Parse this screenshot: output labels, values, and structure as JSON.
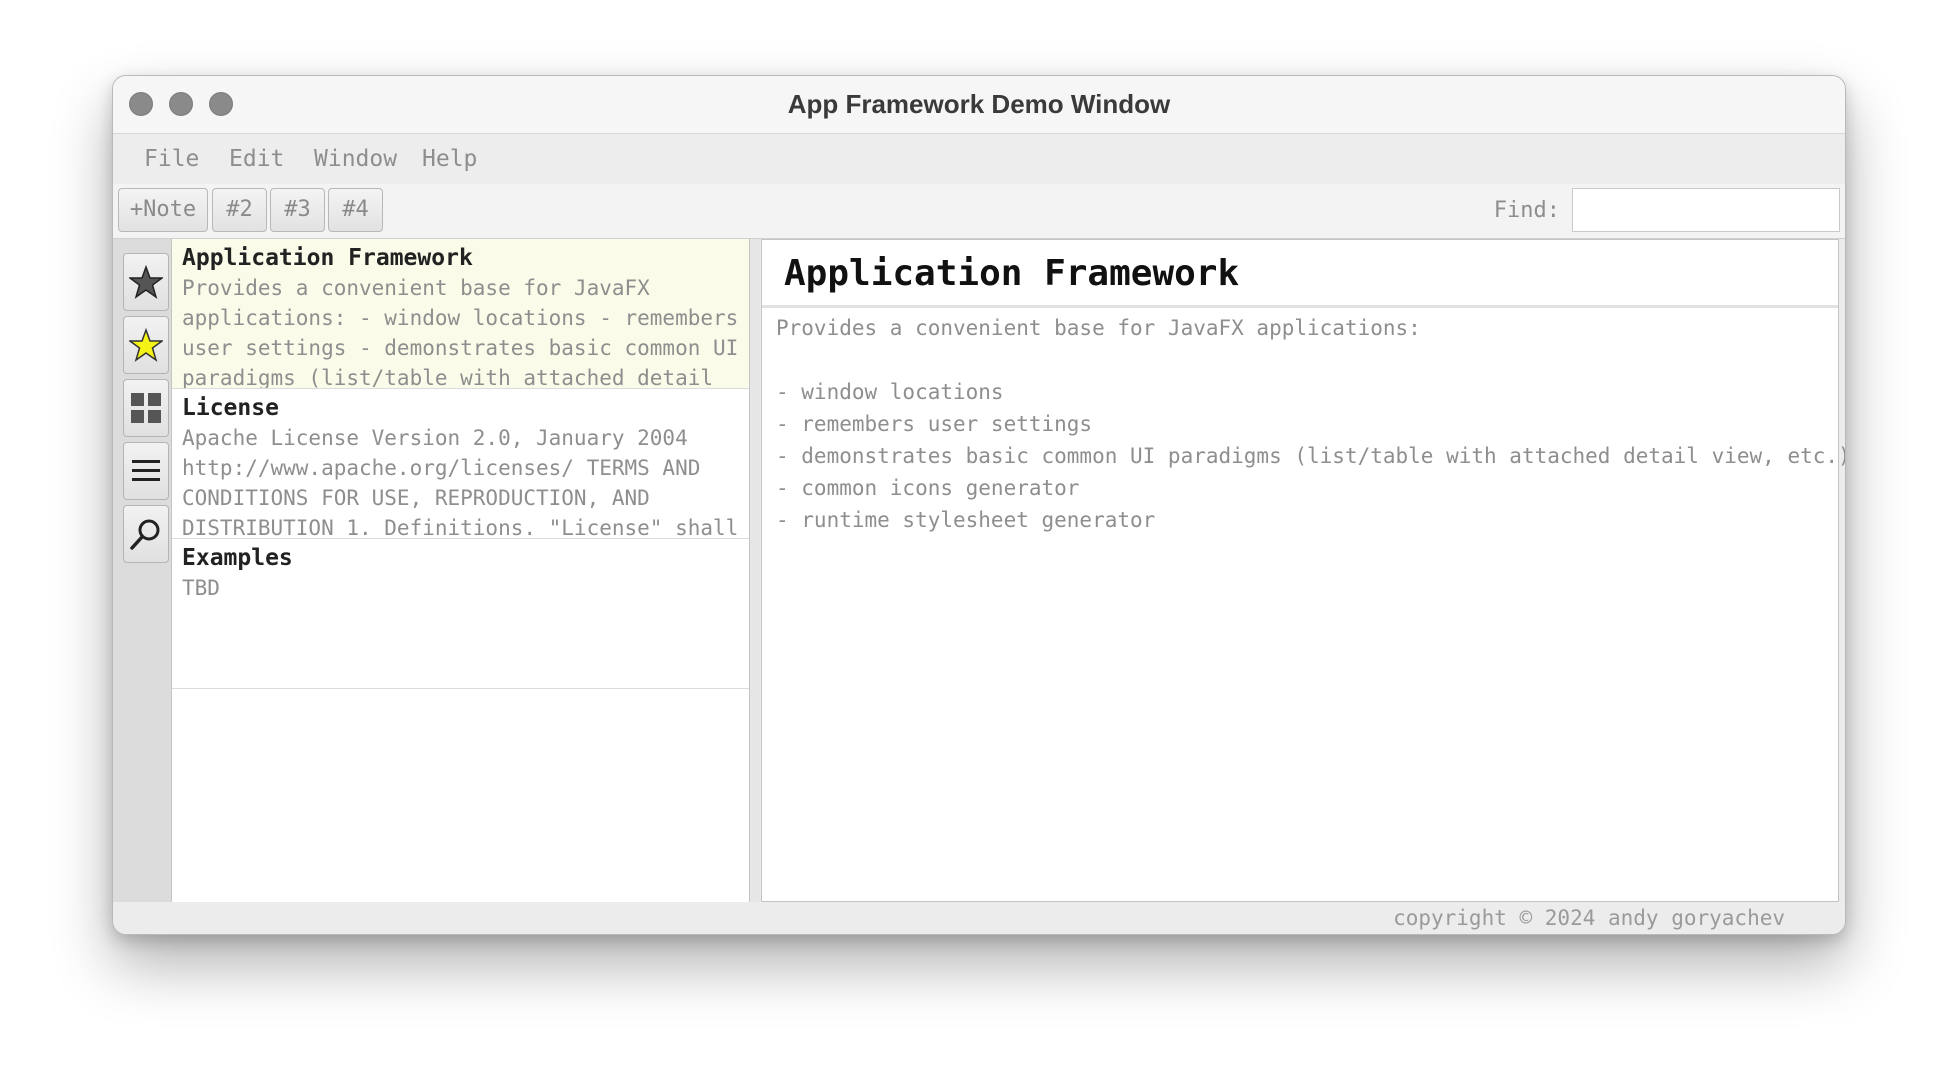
{
  "window": {
    "title": "App Framework Demo Window"
  },
  "menu": {
    "items": [
      "File",
      "Edit",
      "Window",
      "Help"
    ]
  },
  "toolbar": {
    "buttons": [
      "+Note",
      "#2",
      "#3",
      "#4"
    ],
    "find_label": "Find:",
    "find_value": ""
  },
  "sidebar": {
    "buttons": [
      {
        "name": "star-outline-icon",
        "color": "#555555"
      },
      {
        "name": "star-yellow-icon",
        "color": "#f5f216"
      },
      {
        "name": "grid-icon",
        "color": "#555555"
      },
      {
        "name": "list-lines-icon",
        "color": "#222222"
      },
      {
        "name": "search-icon",
        "color": "#222222"
      }
    ]
  },
  "list": {
    "items": [
      {
        "title": "Application Framework",
        "body": "Provides a convenient base for JavaFX applications: - window locations - remembers user settings - demonstrates basic common UI paradigms (list/table with attached detail",
        "selected": true
      },
      {
        "title": "License",
        "body": "Apache License Version 2.0, January 2004 http://www.apache.org/licenses/ TERMS AND CONDITIONS FOR USE, REPRODUCTION, AND DISTRIBUTION 1. Definitions. \"License\" shall",
        "selected": false
      },
      {
        "title": "Examples",
        "body": "TBD",
        "selected": false
      }
    ]
  },
  "detail": {
    "title": "Application Framework",
    "lines": [
      "Provides a convenient base for JavaFX applications:",
      "",
      "- window locations",
      "- remembers user settings",
      "- demonstrates basic common UI paradigms (list/table with attached detail view, etc.)",
      "- common icons generator",
      "- runtime stylesheet generator"
    ]
  },
  "status": {
    "copyright": "copyright © 2024 andy goryachev"
  },
  "colors": {
    "selected_row": "#fbfbe9",
    "traffic_light": "#8a8a8a",
    "star_yellow": "#f5f216"
  }
}
